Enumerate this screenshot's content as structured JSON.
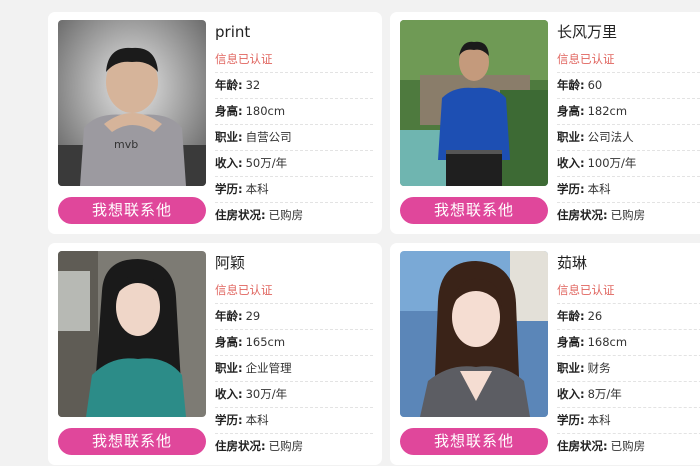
{
  "profiles": [
    {
      "name": "print",
      "verified": "信息已认证",
      "age_label": "年龄:",
      "age": "32",
      "height_label": "身高:",
      "height": "180cm",
      "job_label": "职业:",
      "job": "自营公司",
      "income_label": "收入:",
      "income": "50万/年",
      "edu_label": "学历:",
      "edu": "本科",
      "housing_label": "住房状况:",
      "housing": "已购房",
      "button": "我想联系他"
    },
    {
      "name": "长风万里",
      "verified": "信息已认证",
      "age_label": "年龄:",
      "age": "60",
      "height_label": "身高:",
      "height": "182cm",
      "job_label": "职业:",
      "job": "公司法人",
      "income_label": "收入:",
      "income": "100万/年",
      "edu_label": "学历:",
      "edu": "本科",
      "housing_label": "住房状况:",
      "housing": "已购房",
      "button": "我想联系他"
    },
    {
      "name": "阿颖",
      "verified": "信息已认证",
      "age_label": "年龄:",
      "age": "29",
      "height_label": "身高:",
      "height": "165cm",
      "job_label": "职业:",
      "job": "企业管理",
      "income_label": "收入:",
      "income": "30万/年",
      "edu_label": "学历:",
      "edu": "本科",
      "housing_label": "住房状况:",
      "housing": "已购房",
      "button": "我想联系他"
    },
    {
      "name": "茹琳",
      "verified": "信息已认证",
      "age_label": "年龄:",
      "age": "26",
      "height_label": "身高:",
      "height": "168cm",
      "job_label": "职业:",
      "job": "财务",
      "income_label": "收入:",
      "income": "8万/年",
      "edu_label": "学历:",
      "edu": "本科",
      "housing_label": "住房状况:",
      "housing": "已购房",
      "button": "我想联系他"
    }
  ],
  "colors": {
    "accent": "#e0479b",
    "verified": "#e0655f"
  }
}
